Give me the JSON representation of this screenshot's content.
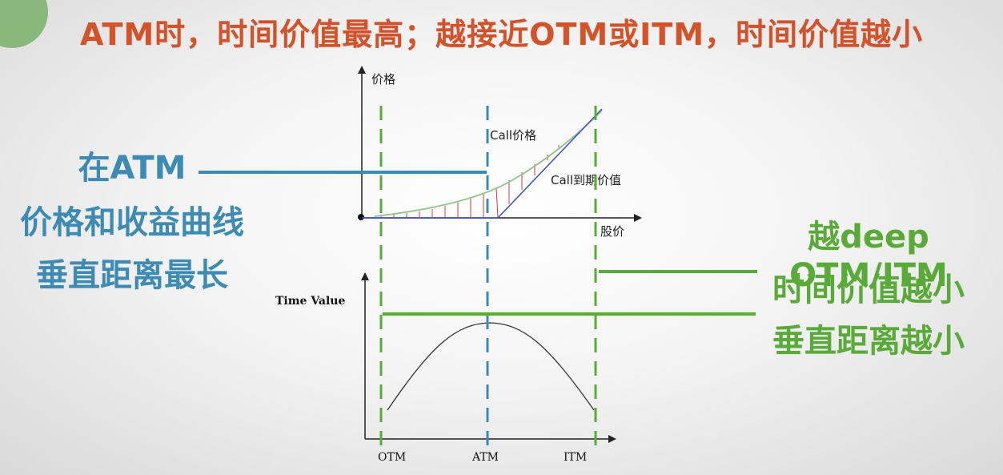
{
  "title": "ATM时，时间价值最高；越接近OTM或ITM，时间价值越小",
  "left_note": {
    "line1": "在ATM",
    "line2": "价格和收益曲线",
    "line3": "垂直距离最长"
  },
  "right_note": {
    "line1": "越deep OTM/ITM",
    "line2": "时间价值越小",
    "line3": "垂直距离越小"
  },
  "top_chart": {
    "y_axis_label": "价格",
    "x_axis_label": "股价",
    "call_price_label": "Call价格",
    "call_expiry_label": "Call到期价值"
  },
  "bottom_chart": {
    "y_axis_label": "Time Value",
    "x_ticks": [
      "OTM",
      "ATM",
      "ITM"
    ]
  },
  "colors": {
    "title": "#d2522a",
    "atm_blue": "#3d8ab3",
    "green": "#5aaa3a",
    "curve_green": "#8fc48a",
    "payoff_blue": "#3b4fc4",
    "hatch_red": "#d23b3b"
  }
}
